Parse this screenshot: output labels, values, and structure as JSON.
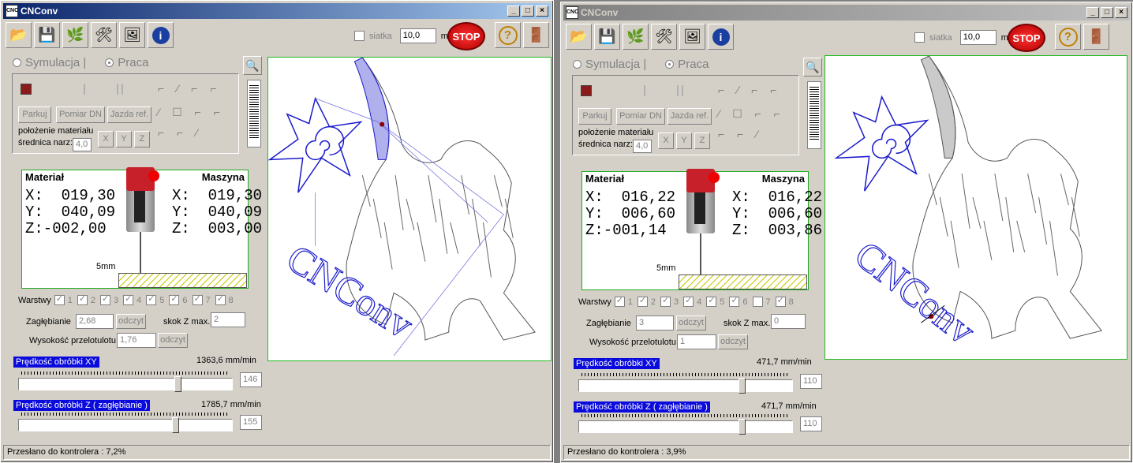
{
  "windows": [
    {
      "title": "CNConv",
      "grid_label": "siatka",
      "grid_value": "10,0",
      "grid_unit": "mm",
      "stop": "STOP",
      "mode_sim": "Symulacja",
      "mode_work": "Praca",
      "buttons": {
        "park": "Parkuj",
        "measure": "Pomiar DN",
        "ref": "Jazda ref."
      },
      "material_pos": "położenie materiału",
      "tool_diam": "średnica narz:",
      "tool_diam_val": "4,0",
      "axes": [
        "X",
        "Y",
        "Z"
      ],
      "machine": {
        "material": "Materiał",
        "machine": "Maszyna",
        "mx": "X:  019,30",
        "my": "Y:  040,09",
        "mz": "Z:-002,00",
        "sx": "X:  019,30",
        "sy": "Y:  040,09",
        "sz": "Z:  003,00",
        "depth_mark": "5mm"
      },
      "layers_label": "Warstwy",
      "layers": [
        "1",
        "2",
        "3",
        "4",
        "5",
        "6",
        "7",
        "8"
      ],
      "plunge_label": "Zagłębianie",
      "plunge_val": "2,68",
      "read": "odczyt",
      "zstep_label": "skok Z max.",
      "zstep_val": "2",
      "travel_label": "Wysokość przelotulotu",
      "travel_val": "1,76",
      "speed_xy_label": "Prędkość obróbki XY",
      "speed_xy_val": "1363,6 mm/min",
      "speed_xy_box": "146",
      "speed_xy_frac": 0.75,
      "speed_z_label": "Prędkość obróbki Z ( zagłębianie )",
      "speed_z_val": "1785,7 mm/min",
      "speed_z_box": "155",
      "speed_z_frac": 0.74,
      "status": "Przesłano do kontrolera : 7,2%",
      "logo_text": "CNConv"
    },
    {
      "title": "CNConv",
      "grid_label": "siatka",
      "grid_value": "10,0",
      "grid_unit": "mm",
      "stop": "STOP",
      "mode_sim": "Symulacja",
      "mode_work": "Praca",
      "buttons": {
        "park": "Parkuj",
        "measure": "Pomiar DN",
        "ref": "Jazda ref."
      },
      "material_pos": "położenie materiału",
      "tool_diam": "średnica narz:",
      "tool_diam_val": "4,0",
      "axes": [
        "X",
        "Y",
        "Z"
      ],
      "machine": {
        "material": "Materiał",
        "machine": "Maszyna",
        "mx": "X:  016,22",
        "my": "Y:  006,60",
        "mz": "Z:-001,14",
        "sx": "X:  016,22",
        "sy": "Y:  006,60",
        "sz": "Z:  003,86",
        "depth_mark": "5mm"
      },
      "layers_label": "Warstwy",
      "layers": [
        "1",
        "2",
        "3",
        "4",
        "5",
        "6",
        "7",
        "8"
      ],
      "plunge_label": "Zagłębianie",
      "plunge_val": "3",
      "read": "odczyt",
      "zstep_label": "skok Z max.",
      "zstep_val": "0",
      "travel_label": "Wysokość przelotulotu",
      "travel_val": "1",
      "speed_xy_label": "Prędkość obróbki XY",
      "speed_xy_val": "471,7 mm/min",
      "speed_xy_box": "110",
      "speed_xy_frac": 0.77,
      "speed_z_label": "Prędkość obróbki Z ( zagłębianie )",
      "speed_z_val": "471,7 mm/min",
      "speed_z_box": "110",
      "speed_z_frac": 0.77,
      "status": "Przesłano do kontrolera : 3,9%",
      "logo_text": "CNConv"
    }
  ]
}
